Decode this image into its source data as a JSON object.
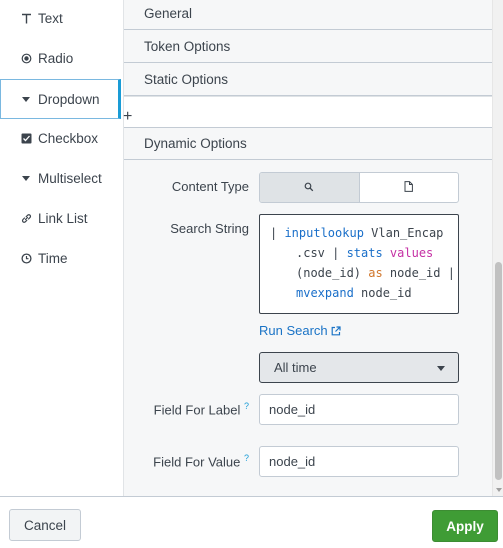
{
  "input_types": [
    {
      "label": "Text",
      "icon": "text-t-icon"
    },
    {
      "label": "Radio",
      "icon": "radio-icon"
    },
    {
      "label": "Dropdown",
      "icon": "caret-down-icon"
    },
    {
      "label": "Checkbox",
      "icon": "checkbox-icon"
    },
    {
      "label": "Multiselect",
      "icon": "caret-down-icon"
    },
    {
      "label": "Link List",
      "icon": "link-icon"
    },
    {
      "label": "Time",
      "icon": "clock-icon"
    }
  ],
  "active_type": "Dropdown",
  "sections": {
    "general": "General",
    "token_options": "Token Options",
    "static_options": "Static Options",
    "dynamic_options": "Dynamic Options"
  },
  "plus_label": "+",
  "dynamic": {
    "content_type_label": "Content Type",
    "search_string_label": "Search String",
    "search_lines": {
      "l1_pipe": "| ",
      "l1_cmd": "inputlookup",
      "l1_rest": " Vlan_Encap",
      "l2": ".csv | ",
      "l2_cmd": "stats",
      "l2_fn": " values",
      "l3_a": "(node_id) ",
      "l3_as": "as",
      "l3_b": " node_id |",
      "l4_cmd": "mvexpand",
      "l4_rest": " node_id"
    },
    "run_search": "Run Search",
    "time_range": "All time",
    "field_for_label": "Field For Label",
    "field_for_label_value": "node_id",
    "field_for_value": "Field For Value",
    "field_for_value_value": "node_id",
    "help_mark": "?"
  },
  "footer": {
    "cancel": "Cancel",
    "apply": "Apply"
  },
  "colors": {
    "accent": "#1a9cd6",
    "apply_green": "#3f9c35",
    "link_blue": "#1a73c6"
  }
}
